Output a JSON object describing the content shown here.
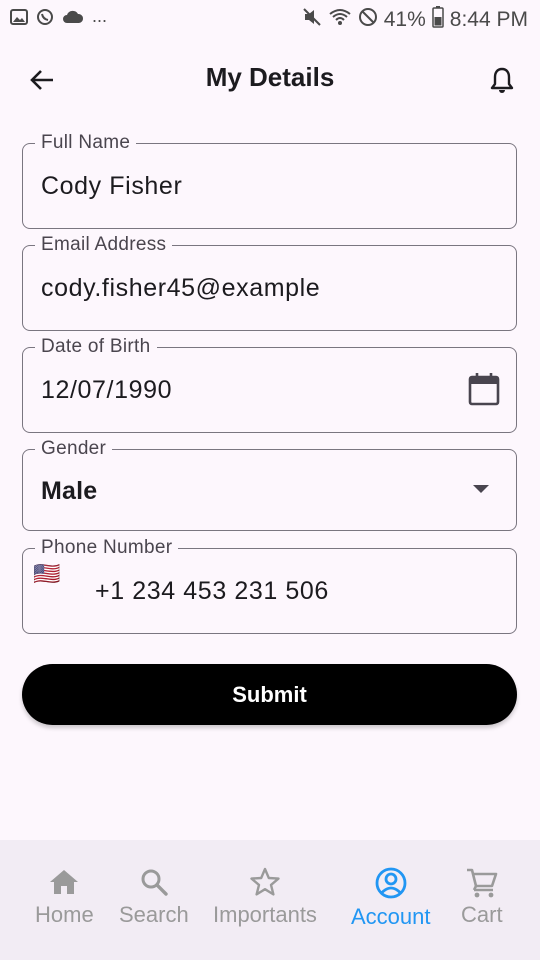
{
  "status_bar": {
    "time": "8:44 PM",
    "battery": "41%",
    "overflow": "..."
  },
  "app_bar": {
    "title": "My Details"
  },
  "form": {
    "full_name": {
      "label": "Full Name",
      "value": "Cody Fisher"
    },
    "email": {
      "label": "Email Address",
      "value": "cody.fisher45@example"
    },
    "dob": {
      "label": "Date of Birth",
      "value": "12/07/1990"
    },
    "gender": {
      "label": "Gender",
      "value": "Male"
    },
    "phone": {
      "label": "Phone Number",
      "value": "+1 234 453 231 506",
      "flag": "🇺🇸"
    }
  },
  "submit_label": "Submit",
  "bottom_nav": {
    "items": [
      {
        "label": "Home",
        "icon": "home-icon"
      },
      {
        "label": "Search",
        "icon": "search-icon"
      },
      {
        "label": "Importants",
        "icon": "star-icon"
      },
      {
        "label": "Account",
        "icon": "account-icon",
        "active": true
      },
      {
        "label": "Cart",
        "icon": "cart-icon"
      }
    ]
  },
  "colors": {
    "background": "#fdf7fd",
    "accent": "#2196f3",
    "nav_inactive": "#9a9a9a",
    "button": "#000000"
  }
}
